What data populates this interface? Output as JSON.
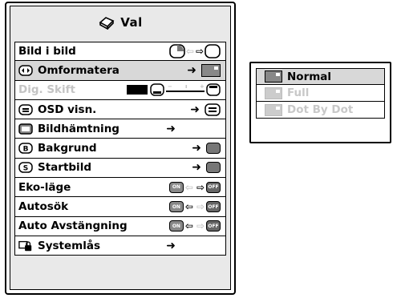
{
  "menu": {
    "title": "Val",
    "rows": [
      {
        "label": "Bild i bild"
      },
      {
        "label": "Omformatera"
      },
      {
        "label": "Dig. Skift"
      },
      {
        "label": "OSD visn."
      },
      {
        "label": "Bildhämtning"
      },
      {
        "label": "Bakgrund"
      },
      {
        "label": "Startbild"
      },
      {
        "label": "Eko-läge"
      },
      {
        "label": "Autosök"
      },
      {
        "label": "Auto Avstängning"
      },
      {
        "label": "Systemlås"
      }
    ],
    "on_label": "ON",
    "off_label": "OFF",
    "arrow": "➜"
  },
  "submenu": {
    "options": [
      "Normal",
      "Full",
      "Dot By Dot"
    ],
    "selected": "Normal"
  }
}
